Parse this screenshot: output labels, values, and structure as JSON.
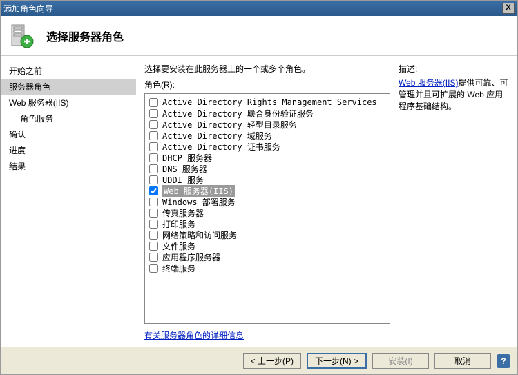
{
  "titlebar": {
    "title": "添加角色向导"
  },
  "header": {
    "title": "选择服务器角色"
  },
  "sidebar": {
    "items": [
      {
        "label": "开始之前",
        "indent": false,
        "active": false
      },
      {
        "label": "服务器角色",
        "indent": false,
        "active": true
      },
      {
        "label": "Web 服务器(IIS)",
        "indent": false,
        "active": false
      },
      {
        "label": "角色服务",
        "indent": true,
        "active": false
      },
      {
        "label": "确认",
        "indent": false,
        "active": false
      },
      {
        "label": "进度",
        "indent": false,
        "active": false
      },
      {
        "label": "结果",
        "indent": false,
        "active": false
      }
    ]
  },
  "main": {
    "instruction": "选择要安装在此服务器上的一个或多个角色。",
    "roles_label": "角色(R):",
    "roles": [
      {
        "label": "Active Directory Rights Management Services",
        "checked": false,
        "selected": false
      },
      {
        "label": "Active Directory 联合身份验证服务",
        "checked": false,
        "selected": false
      },
      {
        "label": "Active Directory 轻型目录服务",
        "checked": false,
        "selected": false
      },
      {
        "label": "Active Directory 域服务",
        "checked": false,
        "selected": false
      },
      {
        "label": "Active Directory 证书服务",
        "checked": false,
        "selected": false
      },
      {
        "label": "DHCP 服务器",
        "checked": false,
        "selected": false
      },
      {
        "label": "DNS 服务器",
        "checked": false,
        "selected": false
      },
      {
        "label": "UDDI 服务",
        "checked": false,
        "selected": false
      },
      {
        "label": "Web 服务器(IIS)",
        "checked": true,
        "selected": true
      },
      {
        "label": "Windows 部署服务",
        "checked": false,
        "selected": false
      },
      {
        "label": "传真服务器",
        "checked": false,
        "selected": false
      },
      {
        "label": "打印服务",
        "checked": false,
        "selected": false
      },
      {
        "label": "网络策略和访问服务",
        "checked": false,
        "selected": false
      },
      {
        "label": "文件服务",
        "checked": false,
        "selected": false
      },
      {
        "label": "应用程序服务器",
        "checked": false,
        "selected": false
      },
      {
        "label": "终端服务",
        "checked": false,
        "selected": false
      }
    ],
    "more_link": "有关服务器角色的详细信息"
  },
  "description": {
    "title": "描述:",
    "link": "Web 服务器(IIS)",
    "text": "提供可靠、可管理并且可扩展的 Web 应用程序基础结构。"
  },
  "footer": {
    "prev": "< 上一步(P)",
    "next": "下一步(N) >",
    "install": "安装(I)",
    "cancel": "取消"
  }
}
